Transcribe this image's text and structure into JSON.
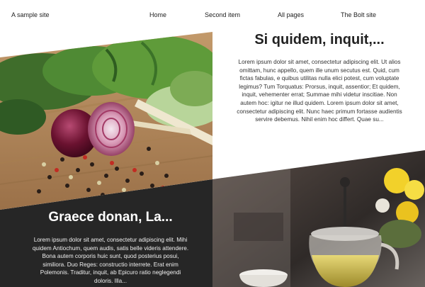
{
  "site": {
    "title": "A sample site"
  },
  "nav": {
    "items": [
      {
        "label": "Home"
      },
      {
        "label": "Second item"
      },
      {
        "label": "All pages"
      },
      {
        "label": "The Bolt site"
      }
    ]
  },
  "article1": {
    "title": "Si quidem, inquit,...",
    "excerpt": "Lorem ipsum dolor sit amet, consectetur adipiscing elit. Ut alios omittam, hunc appello, quem ille unum secutus est. Quid, cum fictas fabulas, e quibus utilitas nulla elici potest, cum voluptate legimus? Tum Torquatus: Prorsus, inquit, assentior; Et quidem, inquit, vehementer errat; Summae mihi videtur inscitiae. Non autem hoc: igitur ne illud quidem. Lorem ipsum dolor sit amet, consectetur adipiscing elit. Nunc haec primum fortasse audientis servire debemus. Nihil enim hoc differt. Quae su..."
  },
  "article2": {
    "title": "Graece donan, La...",
    "excerpt": "Lorem ipsum dolor sit amet, consectetur adipiscing elit. Mihi quidem Antiochum, quem audis, satis belle videris attendere. Bona autem corporis huic sunt, quod posterius posui, similiora. Duo Reges: constructio interrete. Erat enim Polemonis. Traditur, inquit, ab Epicuro ratio neglegendi doloris. Illa..."
  },
  "colors": {
    "dark_panel": "#262626",
    "text": "#222222"
  }
}
